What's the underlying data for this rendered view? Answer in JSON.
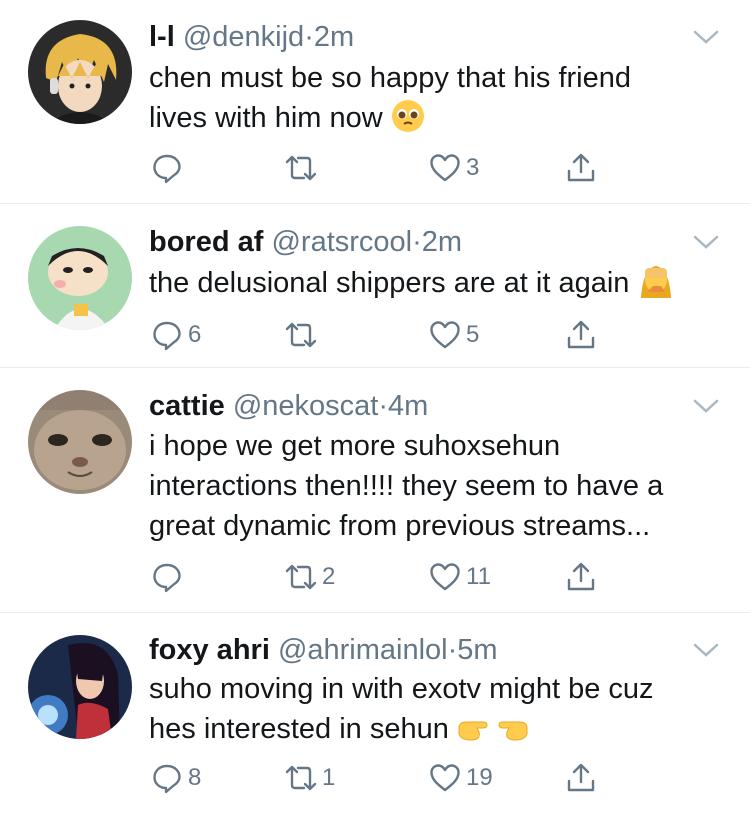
{
  "tweets": [
    {
      "name": "l-l",
      "handle": "@denkijd",
      "separator": "·",
      "time": "2m",
      "text_lines": [
        "chen must be so happy that his friend",
        "lives with him now"
      ],
      "emoji": "pleading-face",
      "replies": "",
      "retweets": "",
      "likes": "3"
    },
    {
      "name": "bored af",
      "handle": "@ratsrcool",
      "separator": "·",
      "time": "2m",
      "text_lines": [
        "the delusional shippers are at it again"
      ],
      "emoji": "woman-facepalming",
      "replies": "6",
      "retweets": "",
      "likes": "5"
    },
    {
      "name": "cattie",
      "handle": "@nekoscat",
      "separator": "·",
      "time": "4m",
      "text_lines": [
        "i hope we get more suhoxsehun",
        "interactions then!!!! they seem to have a",
        "great dynamic from previous streams..."
      ],
      "emoji": "",
      "replies": "",
      "retweets": "2",
      "likes": "11"
    },
    {
      "name": "foxy ahri",
      "handle": "@ahrimainlol",
      "separator": "·",
      "time": "5m",
      "text_lines": [
        "suho moving in with exotv might be cuz",
        "hes interested in sehun"
      ],
      "emoji": "backhand-index-pointing-right-left",
      "replies": "8",
      "retweets": "1",
      "likes": "19"
    }
  ],
  "icons": {
    "reply": "reply-icon",
    "retweet": "retweet-icon",
    "like": "heart-icon",
    "share": "share-icon",
    "more": "chevron-down-icon"
  },
  "colors": {
    "text": "#14171a",
    "secondary": "#657786",
    "divider": "#e6ecf0"
  }
}
